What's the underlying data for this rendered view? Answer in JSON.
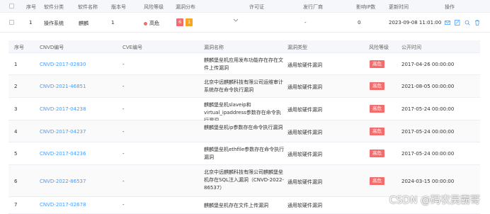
{
  "outer_table": {
    "headers": {
      "index": "序号",
      "category": "软件分类",
      "name": "软件名称",
      "version": "版本号",
      "risk_level": "风险等级",
      "vuln_dist": "漏洞分布",
      "license": "许可证",
      "vendor": "发行厂商",
      "ip_count": "影响IP数",
      "update_time": "更新时间",
      "actions": "操作"
    },
    "row": {
      "index": "1",
      "category": "操作系统",
      "name": "麒麟",
      "version": "1",
      "risk_level": "高危",
      "risk_color": "#f56c6c",
      "vuln_high": "6",
      "vuln_mid": "1",
      "license": "-",
      "vendor": "-",
      "ip_count": "0",
      "update_time": "2023-09-08 11:01:00"
    },
    "action_icons": [
      "mail-icon",
      "edit-icon",
      "search-icon",
      "delete-icon"
    ]
  },
  "inner_table": {
    "headers": {
      "index": "序号",
      "cnvd": "CNVD编号",
      "cve": "CVE编号",
      "name": "漏洞名称",
      "type": "漏洞类型",
      "risk": "风险等级",
      "publish_time": "公开时间"
    },
    "rows": [
      {
        "index": "1",
        "cnvd": "CNVD-2017-02830",
        "cve": "-",
        "name": "麒麟堡垒机应用发布功能存在存在文件上传漏洞",
        "type": "通用软硬件漏洞",
        "risk": "高危",
        "time": "2017-04-26 00:00:00"
      },
      {
        "index": "2",
        "cnvd": "CNVD-2021-46851",
        "cve": "-",
        "name": "北京中远麒麟科技有限公司运维审计系统存在命令执行漏洞",
        "type": "通用软硬件漏洞",
        "risk": "高危",
        "time": "2021-08-05 00:00:00"
      },
      {
        "index": "3",
        "cnvd": "CNVD-2017-04238",
        "cve": "-",
        "name": "麒麟堡垒机slaveip和virtual_ipaddress参数存在命令执行漏洞",
        "type": "通用软硬件漏洞",
        "risk": "高危",
        "time": "2017-05-24 00:00:00"
      },
      {
        "index": "4",
        "cnvd": "CNVD-2017-04237",
        "cve": "-",
        "name": "麒麟堡垒机ip参数存在命令执行漏洞",
        "type": "通用软硬件漏洞",
        "risk": "高危",
        "time": "2017-05-24 00:00:00"
      },
      {
        "index": "5",
        "cnvd": "CNVD-2017-04236",
        "cve": "-",
        "name": "麒麟堡垒机ethfile参数存在命令执行漏洞",
        "type": "通用软硬件漏洞",
        "risk": "高危",
        "time": "2017-05-24 00:00:00"
      },
      {
        "index": "6",
        "cnvd": "CNVD-2022-86537",
        "cve": "-",
        "name": "北京中远麒麟科技有限公司麒麟堡垒机存在SQL注入漏洞（CNVD-2022-86537）",
        "type": "通用软硬件漏洞",
        "risk": "高危",
        "time": "2024-03-15 00:00:00"
      },
      {
        "index": "7",
        "cnvd": "CNVD-2017-02678",
        "cve": "-",
        "name": "麒麟堡垒机存在文件上传漏洞",
        "type": "通用软硬件漏洞",
        "risk": "",
        "time": ""
      }
    ]
  },
  "watermark": "CSDN @码农吴霸哥"
}
